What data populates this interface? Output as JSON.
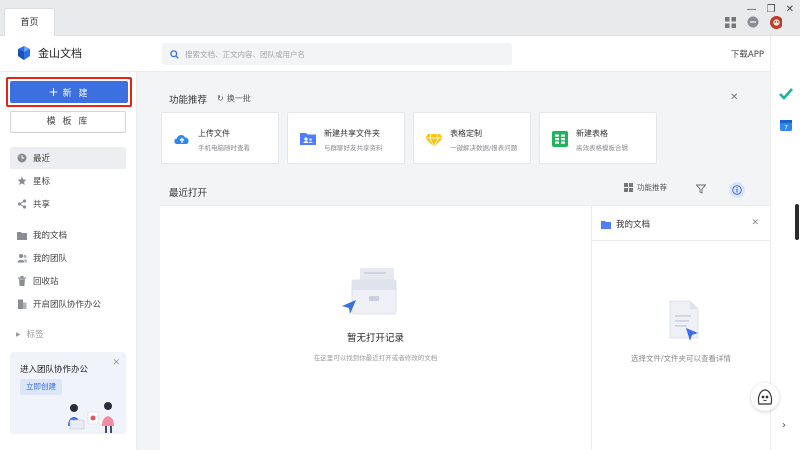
{
  "tabs": {
    "home": "首页"
  },
  "brand": {
    "name": "金山文档"
  },
  "search": {
    "placeholder": "搜索文档、正文内容、团队或用户名"
  },
  "header": {
    "download": "下载APP"
  },
  "sidebar": {
    "new_label": "新 建",
    "template_label": "模 板 库",
    "items": [
      {
        "label": "最近",
        "icon": "clock-icon",
        "active": true
      },
      {
        "label": "星标",
        "icon": "star-icon"
      },
      {
        "label": "共享",
        "icon": "share-icon"
      },
      {
        "label": "我的文档",
        "icon": "folder-icon"
      },
      {
        "label": "我的团队",
        "icon": "team-icon"
      },
      {
        "label": "回收站",
        "icon": "trash-icon"
      },
      {
        "label": "开启团队协作办公",
        "icon": "building-icon"
      }
    ],
    "tags_label": "标签",
    "promo": {
      "title": "进入团队协作办公",
      "button": "立即创建"
    }
  },
  "features": {
    "title": "功能推荐",
    "refresh": "换一批",
    "cards": [
      {
        "title": "上传文件",
        "subtitle": "手机电脑随时查看",
        "icon": "cloud-upload-icon",
        "color": "#2e86f2"
      },
      {
        "title": "新建共享文件夹",
        "subtitle": "与群聊好友共享资料",
        "icon": "shared-folder-icon",
        "color": "#4d7ef7"
      },
      {
        "title": "表格定制",
        "subtitle": "一键解决数据/报表问题",
        "icon": "diamond-icon",
        "color": "#f5c518"
      },
      {
        "title": "新建表格",
        "subtitle": "高效表格模板合辑",
        "icon": "sheet-icon",
        "color": "#1fb35e"
      }
    ]
  },
  "recent": {
    "title": "最近打开",
    "feature_rec": "功能推荐",
    "empty_title": "暂无打开记录",
    "empty_sub": "在这里可以找到你最近打开或者修改的文档"
  },
  "my_docs": {
    "title": "我的文档",
    "hint": "选择文件/文件夹可以查看详情"
  },
  "colors": {
    "accent": "#3c6fe0",
    "highlight_border": "#e8231a"
  }
}
